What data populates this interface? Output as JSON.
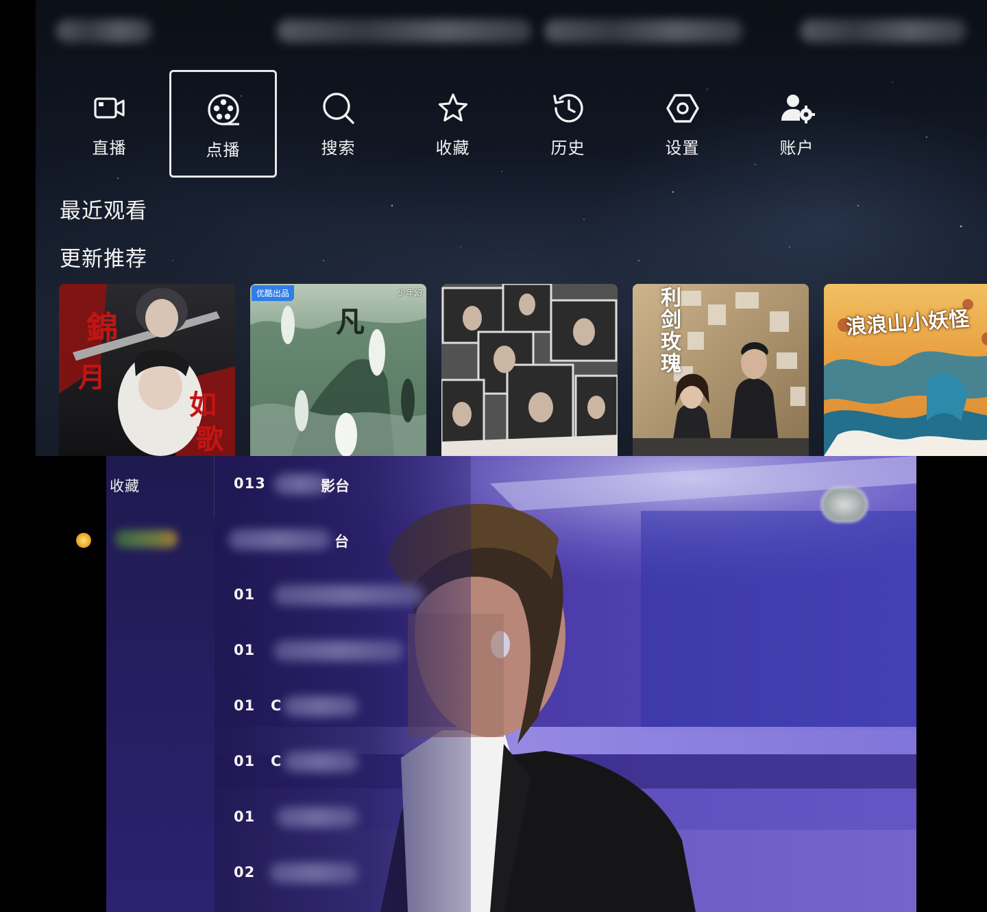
{
  "nav": {
    "items": [
      {
        "label": "直播",
        "icon": "video-camera-icon"
      },
      {
        "label": "点播",
        "icon": "film-reel-icon",
        "focused": true
      },
      {
        "label": "搜索",
        "icon": "search-icon"
      },
      {
        "label": "收藏",
        "icon": "star-icon"
      },
      {
        "label": "历史",
        "icon": "history-icon"
      },
      {
        "label": "设置",
        "icon": "settings-hexagon-icon"
      },
      {
        "label": "账户",
        "icon": "user-settings-icon"
      }
    ]
  },
  "sections": {
    "recent": "最近观看",
    "recommend": "更新推荐"
  },
  "posters": [
    {
      "title": "",
      "badge": "",
      "tag": ""
    },
    {
      "title": "",
      "badge": "优酷出品",
      "tag": "少年幻"
    },
    {
      "title": "",
      "badge": "",
      "tag": ""
    },
    {
      "title": "利剑玫瑰",
      "badge": "",
      "tag": ""
    },
    {
      "title": "浪浪山小妖怪",
      "badge": "",
      "tag": ""
    }
  ],
  "player": {
    "sidebar_header": "收藏",
    "channels": [
      {
        "num": "013",
        "name": "影台"
      },
      {
        "num": "",
        "name": "台"
      },
      {
        "num": "01",
        "name": ""
      },
      {
        "num": "01",
        "name": ""
      },
      {
        "num": "01",
        "name": "C"
      },
      {
        "num": "01",
        "name": "C"
      },
      {
        "num": "01",
        "name": ""
      },
      {
        "num": "02",
        "name": ""
      }
    ]
  },
  "colors": {
    "focus_border": "#e8e8e8",
    "player_bg": "#2a1f6e",
    "badge_blue": "#2f7de8"
  }
}
